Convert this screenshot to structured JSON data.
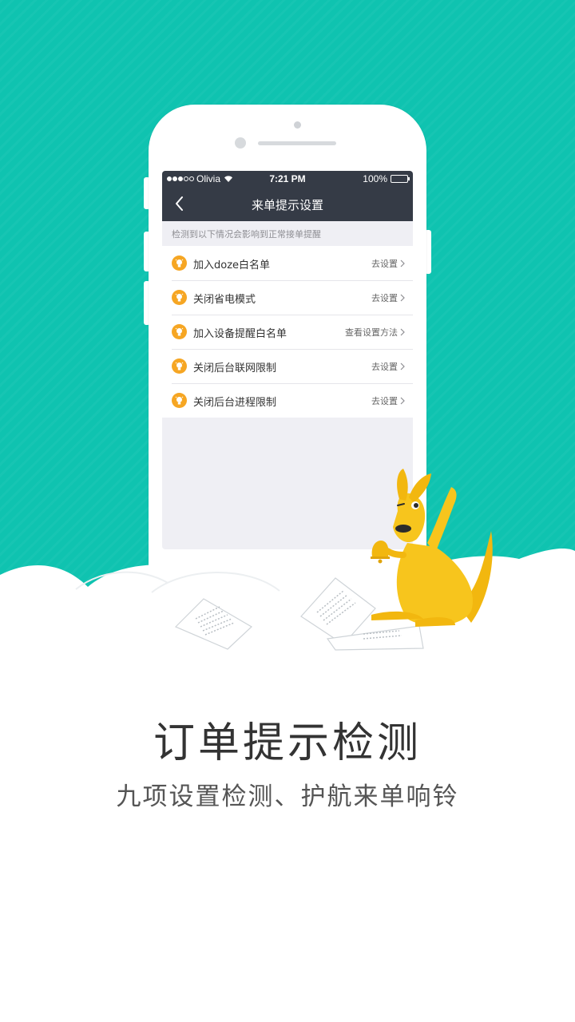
{
  "status_bar": {
    "carrier": "Olivia",
    "time": "7:21 PM",
    "battery": "100%"
  },
  "nav": {
    "title": "来单提示设置"
  },
  "section_header": "检测到以下情况会影响到正常接单提醒",
  "rows": [
    {
      "label": "加入doze白名单",
      "action": "去设置"
    },
    {
      "label": "关闭省电模式",
      "action": "去设置"
    },
    {
      "label": "加入设备提醒白名单",
      "action": "查看设置方法"
    },
    {
      "label": "关闭后台联网限制",
      "action": "去设置"
    },
    {
      "label": "关闭后台进程限制",
      "action": "去设置"
    }
  ],
  "headline": "订单提示检测",
  "subline": "九项设置检测、护航来单响铃",
  "colors": {
    "background_teal": "#0fc3b0",
    "nav_bar": "#353b46",
    "row_icon": "#f6a623",
    "kangaroo": "#f7c51d"
  },
  "icons": [
    "back-icon",
    "bulb-icon",
    "chevron-right-icon",
    "wifi-icon",
    "battery-icon",
    "bell-icon"
  ]
}
